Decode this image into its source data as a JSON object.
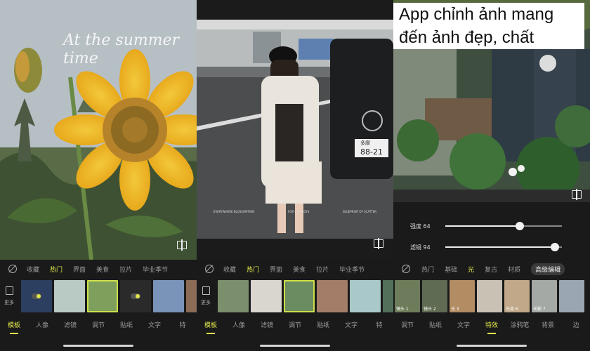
{
  "caption": {
    "line1": "App chỉnh ảnh mang",
    "line2": "đến ảnh đẹp, chất"
  },
  "screen1": {
    "photo_overlay": "At the summer time",
    "tabs": [
      "收藏",
      "热门",
      "界面",
      "美食",
      "拉片",
      "毕业季节"
    ],
    "active_tab": 1,
    "more_label": "更多",
    "thumbs": [
      {
        "color": "#2c3f60",
        "toggle": true,
        "label": ""
      },
      {
        "color": "#b9c9c4",
        "toggle": false,
        "label": ""
      },
      {
        "color": "#7ea05c",
        "toggle": false,
        "label": "",
        "selected": true
      },
      {
        "color": "#2a2a2a",
        "toggle": true,
        "label": ""
      },
      {
        "color": "#7a93b8",
        "toggle": false,
        "label": ""
      },
      {
        "color": "#8c6b57",
        "toggle": false,
        "label": ""
      }
    ],
    "nav": [
      "模板",
      "人像",
      "滤镜",
      "调节",
      "贴纸",
      "文字",
      "特"
    ],
    "active_nav": 0
  },
  "screen2": {
    "plate_top": "多摩",
    "plate_bottom": "88-21",
    "footer_texts": [
      "EVERYWHERE BLOSSOMTION",
      "FOR CITY BOYS",
      "BLUEPRINT OF SCATTER"
    ],
    "tabs": [
      "收藏",
      "热门",
      "界面",
      "美食",
      "拉片",
      "毕业季节"
    ],
    "active_tab": 1,
    "more_label": "更多",
    "thumbs": [
      {
        "color": "#7b8f6c",
        "label": ""
      },
      {
        "color": "#d9d6cf",
        "label": ""
      },
      {
        "color": "#6b8b60",
        "label": "",
        "selected": true
      },
      {
        "color": "#a47d68",
        "label": ""
      },
      {
        "color": "#a9c8c9",
        "label": ""
      },
      {
        "color": "#52705a",
        "label": ""
      }
    ],
    "nav": [
      "模板",
      "人像",
      "滤镜",
      "调节",
      "贴纸",
      "文字",
      "特"
    ],
    "active_nav": 0
  },
  "screen3": {
    "sliders": [
      {
        "label": "强度 64",
        "value": 0.64
      },
      {
        "label": "滤镜 94",
        "value": 0.94
      }
    ],
    "tabs": [
      "热门",
      "基础",
      "光",
      "复古",
      "材质",
      "高级编辑"
    ],
    "active_tab": 2,
    "thumbs": [
      {
        "color": "#6d7c5a",
        "label": "镜头 1"
      },
      {
        "color": "#5f6b52",
        "label": "镜头 2"
      },
      {
        "color": "#b28c63",
        "label": "光 3"
      },
      {
        "color": "#c9c2b4",
        "label": ""
      },
      {
        "color": "#c0a888",
        "label": "光束 6"
      },
      {
        "color": "#a4a9a5",
        "label": "光影 7"
      },
      {
        "color": "#9aa7b2",
        "label": ""
      }
    ],
    "nav": [
      "调节",
      "贴纸",
      "文字",
      "特效",
      "涂鸦笔",
      "背景",
      "边"
    ],
    "active_nav": 3
  },
  "colors": {
    "accent": "#e0e84a",
    "background": "#1a1a1a"
  }
}
